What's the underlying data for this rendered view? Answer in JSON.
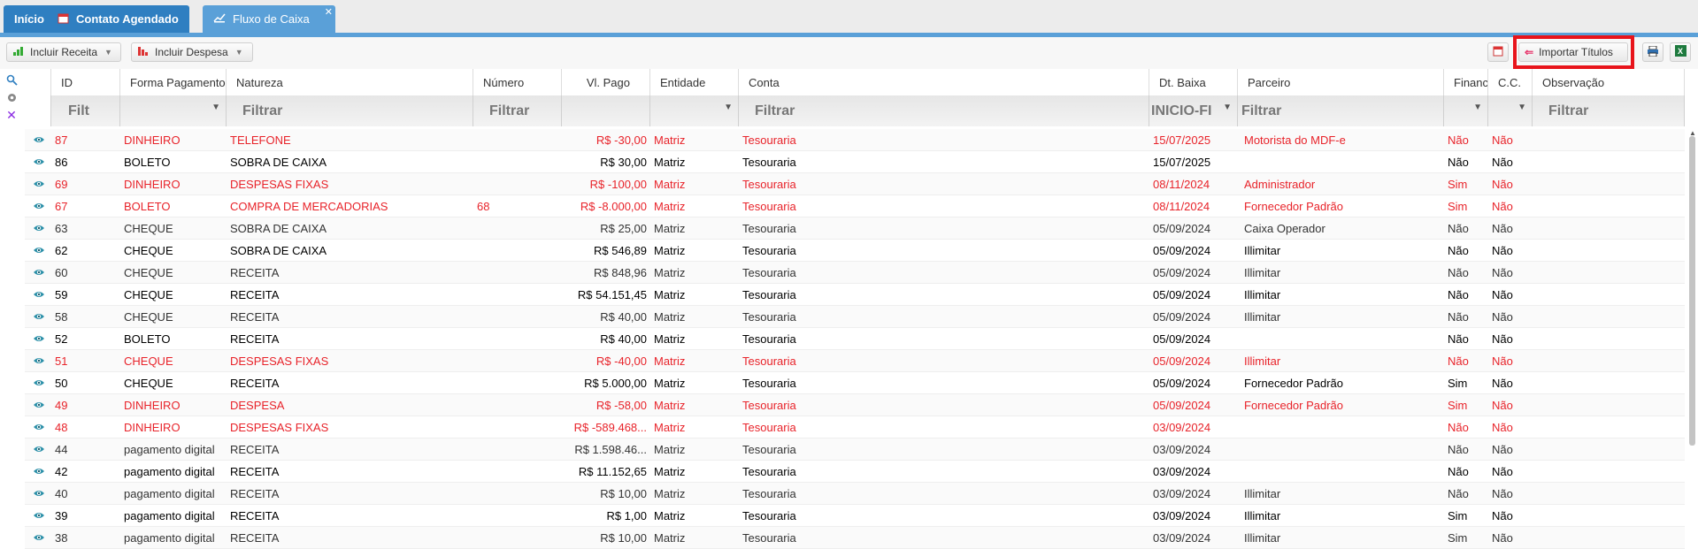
{
  "tabs": [
    {
      "label": "Início"
    },
    {
      "label": "Contato Agendado"
    },
    {
      "label": "Fluxo de Caixa"
    }
  ],
  "toolbar": {
    "incluir_receita": "Incluir Receita",
    "incluir_despesa": "Incluir Despesa",
    "importar_titulos": "Importar Títulos"
  },
  "columns": {
    "id": "ID",
    "forma_pagamento": "Forma Pagamento",
    "natureza": "Natureza",
    "numero": "Número",
    "vl_pago": "Vl. Pago",
    "entidade": "Entidade",
    "conta": "Conta",
    "dt_baixa": "Dt. Baixa",
    "parceiro": "Parceiro",
    "financ": "Financ",
    "cc": "C.C.",
    "observacao": "Observação"
  },
  "filters": {
    "id": "Filt",
    "natureza": "Filtrar",
    "numero": "Filtrar",
    "conta": "Filtrar",
    "dt_baixa": "INICIO-FI",
    "parceiro": "Filtrar",
    "observacao": "Filtrar"
  },
  "rows": [
    {
      "style": "red",
      "id": "87",
      "forma": "DINHEIRO",
      "natureza": "TELEFONE",
      "numero": "",
      "valor": "R$ -30,00",
      "entidade": "Matriz",
      "conta": "Tesouraria",
      "dt": "15/07/2025",
      "parceiro": "Motorista do MDF-e",
      "financ": "Não",
      "cc": "Não"
    },
    {
      "style": "bold",
      "id": "86",
      "forma": "BOLETO",
      "natureza": "SOBRA DE CAIXA",
      "numero": "",
      "valor": "R$ 30,00",
      "entidade": "Matriz",
      "conta": "Tesouraria",
      "dt": "15/07/2025",
      "parceiro": "",
      "financ": "Não",
      "cc": "Não"
    },
    {
      "style": "red",
      "id": "69",
      "forma": "DINHEIRO",
      "natureza": "DESPESAS FIXAS",
      "numero": "",
      "valor": "R$ -100,00",
      "entidade": "Matriz",
      "conta": "Tesouraria",
      "dt": "08/11/2024",
      "parceiro": "Administrador",
      "financ": "Sim",
      "cc": "Não"
    },
    {
      "style": "red",
      "id": "67",
      "forma": "BOLETO",
      "natureza": "COMPRA DE MERCADORIAS",
      "numero": "68",
      "valor": "R$ -8.000,00",
      "entidade": "Matriz",
      "conta": "Tesouraria",
      "dt": "08/11/2024",
      "parceiro": "Fornecedor Padrão",
      "financ": "Sim",
      "cc": "Não"
    },
    {
      "style": "regular",
      "id": "63",
      "forma": "CHEQUE",
      "natureza": "SOBRA DE CAIXA",
      "numero": "",
      "valor": "R$ 25,00",
      "entidade": "Matriz",
      "conta": "Tesouraria",
      "dt": "05/09/2024",
      "parceiro": "Caixa Operador",
      "financ": "Não",
      "cc": "Não"
    },
    {
      "style": "bold",
      "id": "62",
      "forma": "CHEQUE",
      "natureza": "SOBRA DE CAIXA",
      "numero": "",
      "valor": "R$ 546,89",
      "entidade": "Matriz",
      "conta": "Tesouraria",
      "dt": "05/09/2024",
      "parceiro": "Illimitar",
      "financ": "Não",
      "cc": "Não"
    },
    {
      "style": "regular",
      "id": "60",
      "forma": "CHEQUE",
      "natureza": "RECEITA",
      "numero": "",
      "valor": "R$ 848,96",
      "entidade": "Matriz",
      "conta": "Tesouraria",
      "dt": "05/09/2024",
      "parceiro": "Illimitar",
      "financ": "Não",
      "cc": "Não"
    },
    {
      "style": "bold",
      "id": "59",
      "forma": "CHEQUE",
      "natureza": "RECEITA",
      "numero": "",
      "valor": "R$ 54.151,45",
      "entidade": "Matriz",
      "conta": "Tesouraria",
      "dt": "05/09/2024",
      "parceiro": "Illimitar",
      "financ": "Não",
      "cc": "Não"
    },
    {
      "style": "regular",
      "id": "58",
      "forma": "CHEQUE",
      "natureza": "RECEITA",
      "numero": "",
      "valor": "R$ 40,00",
      "entidade": "Matriz",
      "conta": "Tesouraria",
      "dt": "05/09/2024",
      "parceiro": "Illimitar",
      "financ": "Não",
      "cc": "Não"
    },
    {
      "style": "bold",
      "id": "52",
      "forma": "BOLETO",
      "natureza": "RECEITA",
      "numero": "",
      "valor": "R$ 40,00",
      "entidade": "Matriz",
      "conta": "Tesouraria",
      "dt": "05/09/2024",
      "parceiro": "",
      "financ": "Não",
      "cc": "Não"
    },
    {
      "style": "red",
      "id": "51",
      "forma": "CHEQUE",
      "natureza": "DESPESAS FIXAS",
      "numero": "",
      "valor": "R$ -40,00",
      "entidade": "Matriz",
      "conta": "Tesouraria",
      "dt": "05/09/2024",
      "parceiro": "Illimitar",
      "financ": "Não",
      "cc": "Não"
    },
    {
      "style": "bold",
      "id": "50",
      "forma": "CHEQUE",
      "natureza": "RECEITA",
      "numero": "",
      "valor": "R$ 5.000,00",
      "entidade": "Matriz",
      "conta": "Tesouraria",
      "dt": "05/09/2024",
      "parceiro": "Fornecedor Padrão",
      "financ": "Sim",
      "cc": "Não"
    },
    {
      "style": "red",
      "id": "49",
      "forma": "DINHEIRO",
      "natureza": "DESPESA",
      "numero": "",
      "valor": "R$ -58,00",
      "entidade": "Matriz",
      "conta": "Tesouraria",
      "dt": "05/09/2024",
      "parceiro": "Fornecedor Padrão",
      "financ": "Sim",
      "cc": "Não"
    },
    {
      "style": "red",
      "id": "48",
      "forma": "DINHEIRO",
      "natureza": "DESPESAS FIXAS",
      "numero": "",
      "valor": "R$ -589.468...",
      "entidade": "Matriz",
      "conta": "Tesouraria",
      "dt": "03/09/2024",
      "parceiro": "",
      "financ": "Não",
      "cc": "Não"
    },
    {
      "style": "regular",
      "id": "44",
      "forma": "pagamento digital",
      "natureza": "RECEITA",
      "numero": "",
      "valor": "R$ 1.598.46...",
      "entidade": "Matriz",
      "conta": "Tesouraria",
      "dt": "03/09/2024",
      "parceiro": "",
      "financ": "Não",
      "cc": "Não"
    },
    {
      "style": "bold",
      "id": "42",
      "forma": "pagamento digital",
      "natureza": "RECEITA",
      "numero": "",
      "valor": "R$ 11.152,65",
      "entidade": "Matriz",
      "conta": "Tesouraria",
      "dt": "03/09/2024",
      "parceiro": "",
      "financ": "Não",
      "cc": "Não"
    },
    {
      "style": "regular",
      "id": "40",
      "forma": "pagamento digital",
      "natureza": "RECEITA",
      "numero": "",
      "valor": "R$ 10,00",
      "entidade": "Matriz",
      "conta": "Tesouraria",
      "dt": "03/09/2024",
      "parceiro": "Illimitar",
      "financ": "Não",
      "cc": "Não"
    },
    {
      "style": "bold",
      "id": "39",
      "forma": "pagamento digital",
      "natureza": "RECEITA",
      "numero": "",
      "valor": "R$ 1,00",
      "entidade": "Matriz",
      "conta": "Tesouraria",
      "dt": "03/09/2024",
      "parceiro": "Illimitar",
      "financ": "Sim",
      "cc": "Não"
    },
    {
      "style": "regular",
      "id": "38",
      "forma": "pagamento digital",
      "natureza": "RECEITA",
      "numero": "",
      "valor": "R$ 10,00",
      "entidade": "Matriz",
      "conta": "Tesouraria",
      "dt": "03/09/2024",
      "parceiro": "Illimitar",
      "financ": "Sim",
      "cc": "Não"
    }
  ]
}
